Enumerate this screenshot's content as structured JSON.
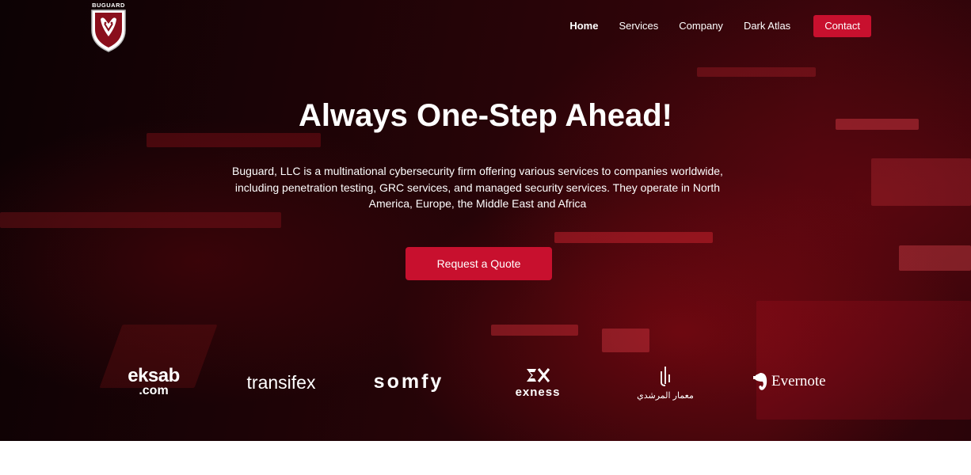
{
  "brand": {
    "logo_text": "BUGUARD",
    "logo_icon": "buguard-shield-icon"
  },
  "nav": {
    "items": [
      {
        "label": "Home",
        "active": true
      },
      {
        "label": "Services",
        "active": false
      },
      {
        "label": "Company",
        "active": false
      },
      {
        "label": "Dark Atlas",
        "active": false
      }
    ],
    "contact_label": "Contact"
  },
  "hero": {
    "title": "Always One-Step Ahead!",
    "description": "Buguard, LLC is a multinational cybersecurity firm offering various services to companies worldwide, including penetration testing, GRC services, and managed security services. They operate in North America, Europe, the Middle East and Africa",
    "cta_label": "Request a Quote"
  },
  "clients": {
    "eksab": {
      "line1": "eksab",
      "line2": ".com"
    },
    "transifex": "transifex",
    "somfy": "somfy",
    "exness": "exness",
    "memar": "معمار المرشدي",
    "evernote": "Evernote"
  },
  "colors": {
    "accent": "#c8102e",
    "background": "#1c0306",
    "text": "#ffffff"
  }
}
